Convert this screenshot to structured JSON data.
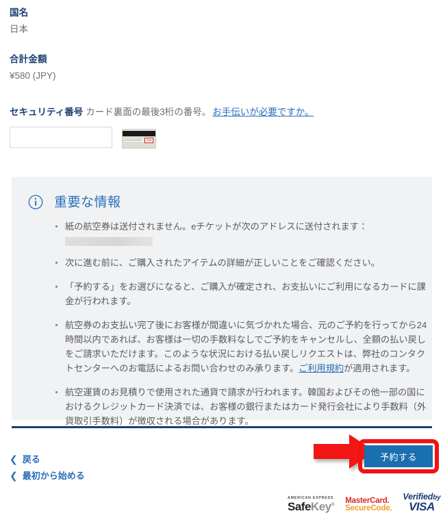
{
  "summary": {
    "country": {
      "label": "国名",
      "value": "日本"
    },
    "total": {
      "label": "合計金額",
      "value": "¥580 (JPY)"
    }
  },
  "security_code": {
    "label": "セキュリティ番号",
    "hint": "カード裏面の最後3桁の番号。",
    "help_link": "お手伝いが必要ですか。",
    "input_value": "",
    "input_placeholder": "",
    "card_image_cvv_digits": "123"
  },
  "important_info": {
    "icon": "info-circle-icon",
    "title": "重要な情報",
    "bullets": [
      {
        "text": "紙の航空券は送付されません。eチケットが次のアドレスに送付されます：",
        "redacted": true
      },
      {
        "text": "次に進む前に、ご購入されたアイテムの詳細が正しいことをご確認ください。",
        "redacted": false
      },
      {
        "text": "「予約する」をお選びになると、ご購入が確定され、お支払いにご利用になるカードに課金が行われます。",
        "redacted": false
      },
      {
        "text_before": "航空券のお支払い完了後にお客様が間違いに気づかれた場合、元のご予約を行ってから24時間以内であれば、お客様は一切の手数料なしでご予約をキャンセルし、全額の払い戻しをご請求いただけます。このような状況における払い戻しリクエストは、弊社のコンタクトセンターへのお電話によるお問い合わせのみ承ります。",
        "link": "ご利用規約",
        "text_after": "が適用されます。",
        "redacted": false
      },
      {
        "text": "航空運賃のお見積りで使用された通貨で請求が行われます。韓国およびその他一部の国におけるクレジットカード決済では、お客様の銀行またはカード発行会社により手数料（外貨取引手数料）が徴収される場合があります。",
        "redacted": false
      }
    ]
  },
  "navigation": {
    "back": {
      "chevron": "chevron-left-icon",
      "label": "戻る"
    },
    "restart": {
      "chevron": "chevron-left-icon",
      "label": "最初から始める"
    }
  },
  "cta": {
    "label": "予約する",
    "highlight_color": "#f21212",
    "button_color": "#1a6fae",
    "arrow_color": "#f21212"
  },
  "payment_logos": {
    "safekey": {
      "top_line": "AMERICAN EXPRESS",
      "name_bold": "Safe",
      "name_light": "Key",
      "mark": "®"
    },
    "mastercard": {
      "line1": "MasterCard.",
      "line2": "SecureCode."
    },
    "visa": {
      "line1": "Verified",
      "line1_by": "by",
      "line2": "VISA"
    }
  },
  "theme": {
    "heading_color": "#1b3f72",
    "link_color": "#2a6ebb",
    "text_color": "#58595b",
    "panel_bg": "#f1f2f3",
    "divider_color": "#1b3f72"
  }
}
